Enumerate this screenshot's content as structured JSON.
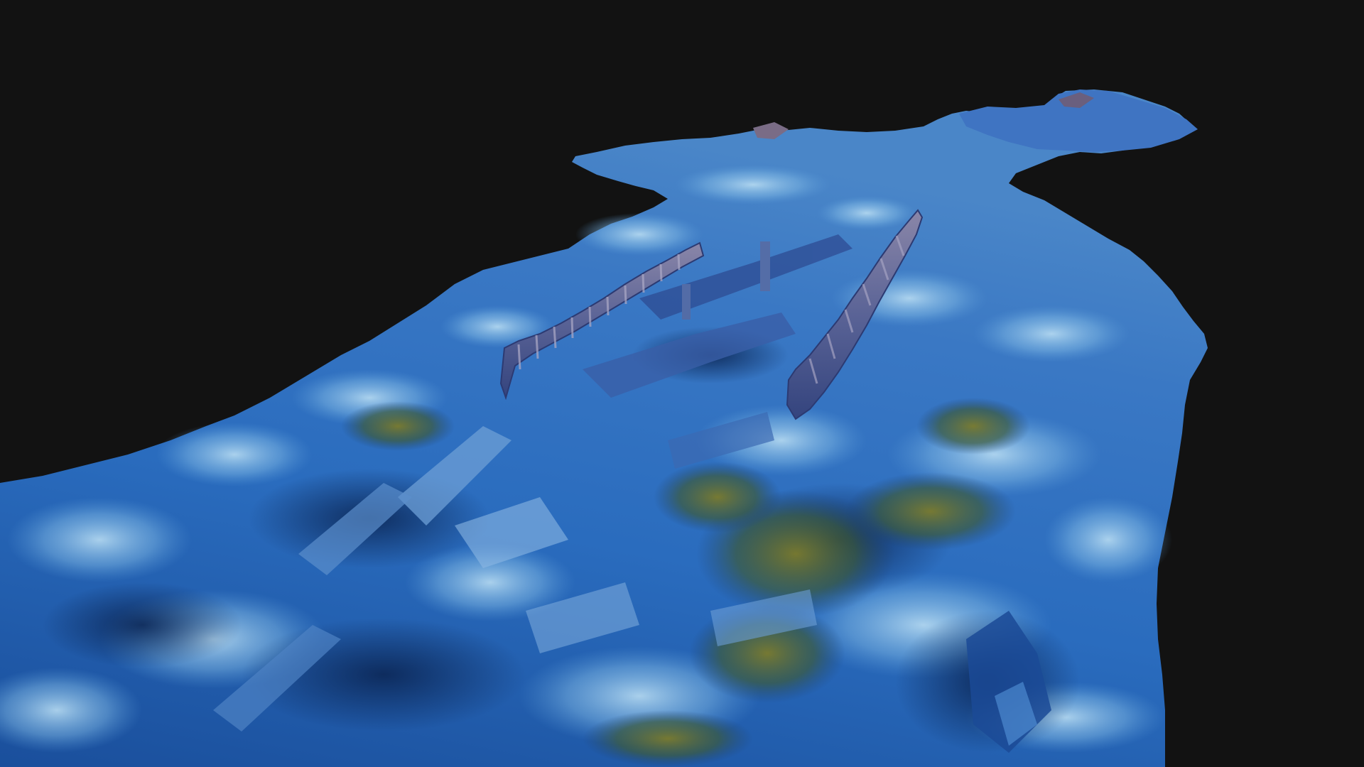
{
  "scene": {
    "subject": "photogrammetry-model-underwater-shipwreck",
    "colors": {
      "background": "#121212",
      "seabed_deep": "#0d2f66",
      "seabed_mid": "#1f5fb4",
      "seabed_light": "#4f9ad8",
      "sand_highlight": "#9cc9ea",
      "algae": "#5b6a2a",
      "algae_bright": "#8a8a30",
      "hull_wood": "#6a6a96"
    }
  }
}
